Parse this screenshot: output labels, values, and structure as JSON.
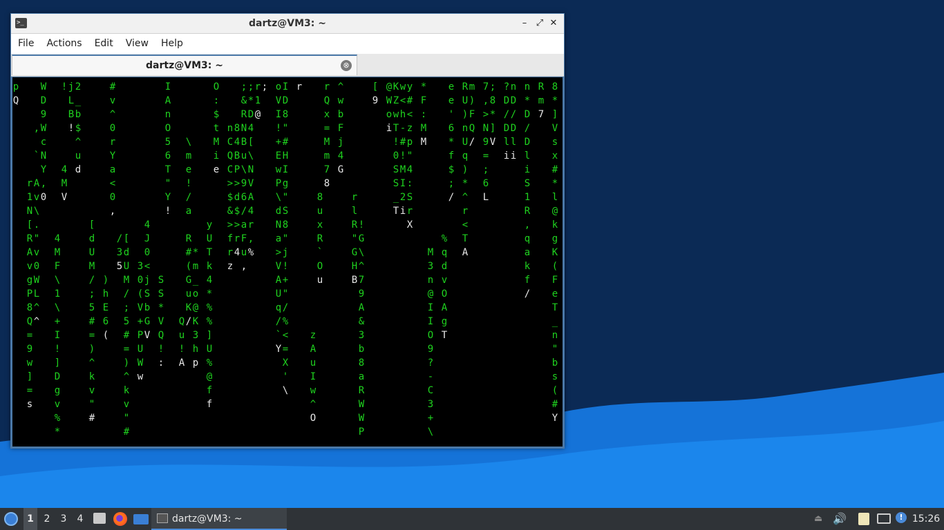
{
  "window": {
    "title": "dartz@VM3: ~",
    "icon": "terminal-icon",
    "buttons": {
      "minimize": "–",
      "maximize": "⤢",
      "close": "✕"
    }
  },
  "menu": [
    "File",
    "Actions",
    "Edit",
    "View",
    "Help"
  ],
  "tab": {
    "label": "dartz@VM3: ~",
    "close_icon": "⊗"
  },
  "terminal": {
    "program": "cmatrix",
    "text_color": "#1fd21f",
    "highlight_color": "#e8e8e8",
    "background": "#000000",
    "columns": [
      "pQ",
      "",
      "       r1N[RAvgP8Q=9w]=s",
      "   , ` Av\\.\"v0WL^^",
      "WD9WcNY,0",
      "",
      "           4MF\\1\\+I!]Dgv%*",
      "!     4MV",
      "jLB!",
      "2_b$^ud",
      "",
      "          [dUM/;5#=)^kv\"#",
      "",
      "              )hE6(",
      "#v^0rYa<0,",
      "           /35",
      "           [dUM/;5#=)^kv\"#",
      "",
      "             30(V+PUWw",
      "          4J0<jSbGV",
      "",
      "              SS*VQ!:",
      "IAnO56T\"Y!",
      "",
      "                 Qu!A",
      "    \\me!/a R#(GuK/",
      "            *m_o@K3hp",
      "",
      "          yUTk4*%%]U%@ff",
      "O:$tMie",
      "",
      "   nCQC>$&>frz",
      "   84BP>d$>r4",
      ";&RNBu\\96/aFu,",
      ";*D4[\\NVA4r,%",
      "r1@",
      ";",
      "",
      "oVI!+EwP\\dNa>VAUq/`Y",
      "ID8\"#HIg\"S8\"j!+\"/%<=X'\\",
      "",
      "r",
      "",
      "                  zAuIw^O",
      "        8uxR`Ou",
      "rQx=Mm78",
      "",
      "^wbFj4G",
      "",
      "        rlR\"GHB",
      "          !G\\^79A&3b8aRWWPZ-",
      "",
      "[9",
      "",
      "@Woi",
      "KZwT!0SS_T",
      "w<h-#!MI2i",
      "y#<zp\"4:SrX",
      "",
      "*F:MM",
      "            M3n@IIO9?-C3+\\",
      "",
      "           %qdvOAgT",
      "ee'6*f$;/",
      "",
      "RU)nUq)*^r<TA",
      "m)FQ/",
      "",
      "7,>N9=;6L",
      ";8*]V",
      "",
      "?D/Dli",
      "nD/Dli",
      "",
      "n*D/DliS1R,qakf/",
      "",
      "Rm7",
      "",
      "8*]Vsx#*l@kgK(FeT_n\"bs(#Y",
      "",
      "              BmF5F!(/JHT6",
      "",
      "              f/V>?8",
      "",
      "8!&.V>Y?8"
    ]
  },
  "taskbar": {
    "start_icon": "lxqt-start-icon",
    "workspaces": [
      "1",
      "2",
      "3",
      "4"
    ],
    "active_workspace": "1",
    "launchers": [
      "files-icon",
      "firefox-icon",
      "desktop-icon"
    ],
    "task_label": "dartz@VM3: ~",
    "tray": [
      "eject-icon",
      "volume-icon",
      "clipboard-icon",
      "network-icon",
      "notification-icon"
    ],
    "notification_glyph": "!",
    "volume_glyph": "🔊",
    "eject_glyph": "⏏",
    "clock": "15:26"
  }
}
